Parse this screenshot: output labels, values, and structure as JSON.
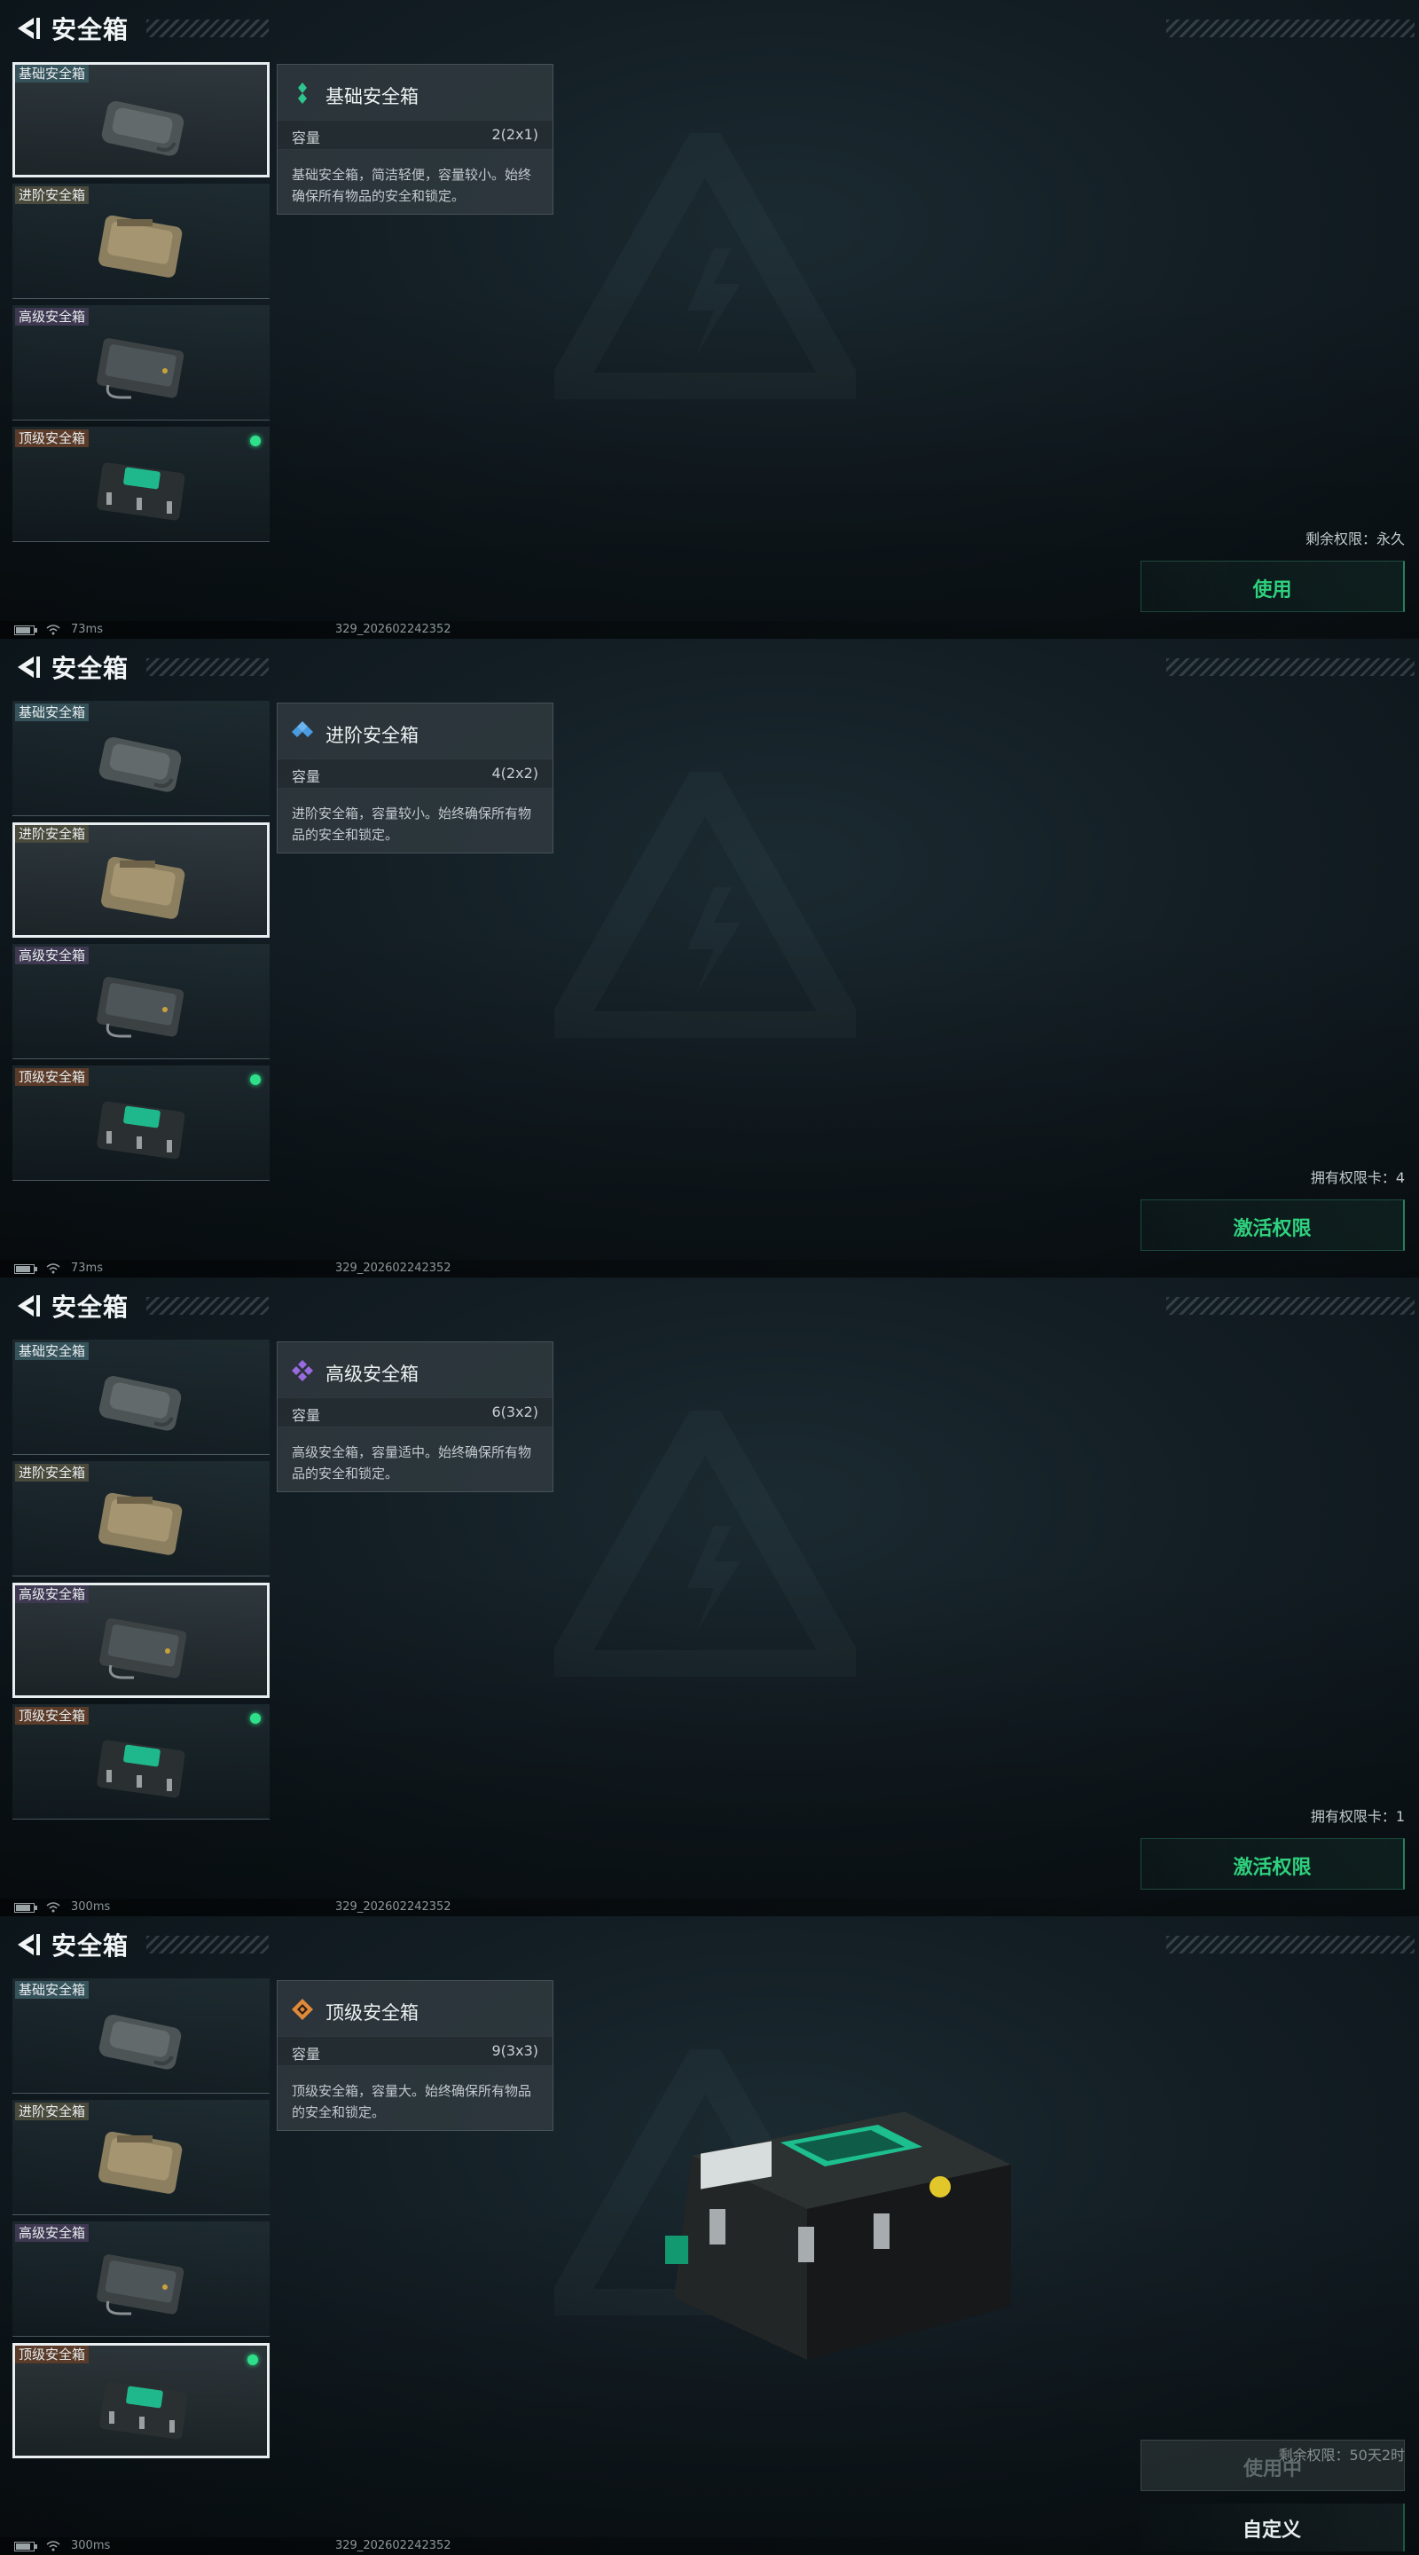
{
  "screens": [
    {
      "title": "安全箱",
      "items": [
        "基础安全箱",
        "进阶安全箱",
        "高级安全箱",
        "顶级安全箱"
      ],
      "info": {
        "name": "基础安全箱",
        "capacity_label": "容量",
        "capacity_value": "2(2x1)",
        "desc": "基础安全箱，简洁轻便，容量较小。始终确保所有物品的安全和锁定。"
      },
      "status": "剩余权限：永久",
      "action": "使用",
      "ping": "73ms",
      "build": "329_202602242352"
    },
    {
      "title": "安全箱",
      "items": [
        "基础安全箱",
        "进阶安全箱",
        "高级安全箱",
        "顶级安全箱"
      ],
      "info": {
        "name": "进阶安全箱",
        "capacity_label": "容量",
        "capacity_value": "4(2x2)",
        "desc": "进阶安全箱，容量较小。始终确保所有物品的安全和锁定。"
      },
      "status": "拥有权限卡：4",
      "action": "激活权限",
      "ping": "73ms",
      "build": "329_202602242352"
    },
    {
      "title": "安全箱",
      "items": [
        "基础安全箱",
        "进阶安全箱",
        "高级安全箱",
        "顶级安全箱"
      ],
      "info": {
        "name": "高级安全箱",
        "capacity_label": "容量",
        "capacity_value": "6(3x2)",
        "desc": "高级安全箱，容量适中。始终确保所有物品的安全和锁定。"
      },
      "status": "拥有权限卡：1",
      "action": "激活权限",
      "ping": "300ms",
      "build": "329_202602242352"
    },
    {
      "title": "安全箱",
      "items": [
        "基础安全箱",
        "进阶安全箱",
        "高级安全箱",
        "顶级安全箱"
      ],
      "info": {
        "name": "顶级安全箱",
        "capacity_label": "容量",
        "capacity_value": "9(3x3)",
        "desc": "顶级安全箱，容量大。始终确保所有物品的安全和锁定。"
      },
      "status": "剩余权限：50天2时",
      "action": "使用中",
      "custom": "自定义",
      "ping": "300ms",
      "build": "329_202602242352"
    }
  ],
  "colors": {
    "accent_green": "#2fd17e",
    "active_dot": "#2fe08a",
    "basic_icon": "#2ec48e",
    "advanced_icon": "#4a9be0",
    "high_icon": "#9a6ae0",
    "top_icon": "#e0893a"
  }
}
